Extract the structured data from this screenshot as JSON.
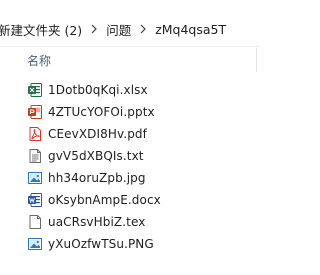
{
  "breadcrumb": {
    "items": [
      "新建文件夹 (2)",
      "问题",
      "zMq4qsa5T"
    ],
    "separator_icon": "chevron-right-icon"
  },
  "columns": {
    "name_label": "名称"
  },
  "files": [
    {
      "name": "1Dotb0qKqi.xlsx",
      "icon": "excel-file-icon",
      "color": "#1e7145"
    },
    {
      "name": "4ZTUcYOFOi.pptx",
      "icon": "powerpoint-file-icon",
      "color": "#c43e1c"
    },
    {
      "name": "CEevXDI8Hv.pdf",
      "icon": "pdf-file-icon",
      "color": "#d9342b"
    },
    {
      "name": "gvV5dXBQIs.txt",
      "icon": "text-file-icon",
      "color": "#6b6b6b"
    },
    {
      "name": "hh34oruZpb.jpg",
      "icon": "image-file-icon",
      "color": "#2b78c5"
    },
    {
      "name": "oKsybnAmpE.docx",
      "icon": "word-file-icon",
      "color": "#2b579a"
    },
    {
      "name": "uaCRsvHbiZ.tex",
      "icon": "generic-file-icon",
      "color": "#6b6b6b"
    },
    {
      "name": "yXuOzfwTSu.PNG",
      "icon": "image-file-icon",
      "color": "#2b78c5"
    }
  ]
}
